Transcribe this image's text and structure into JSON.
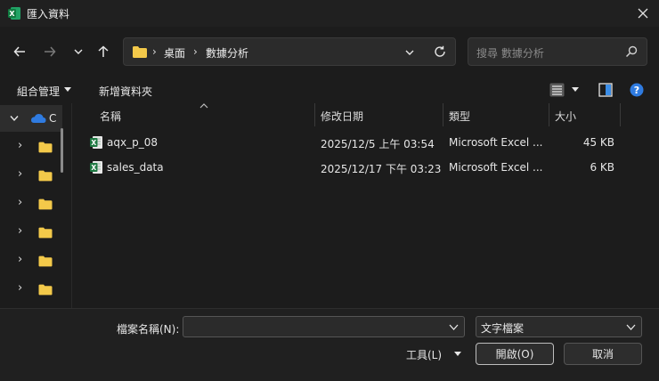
{
  "window": {
    "title": "匯入資料"
  },
  "address": {
    "crumbs": [
      "桌面",
      "數據分析"
    ]
  },
  "search": {
    "placeholder": "搜尋 數據分析"
  },
  "toolbar": {
    "organize": "組合管理",
    "new_folder": "新增資料夾"
  },
  "sidebar": {
    "top_item": "C"
  },
  "columns": {
    "name": "名稱",
    "date": "修改日期",
    "type": "類型",
    "size": "大小"
  },
  "files": [
    {
      "name": "aqx_p_08",
      "date": "2025/12/5 上午 03:54",
      "type": "Microsoft Excel ...",
      "size": "45 KB"
    },
    {
      "name": "sales_data",
      "date": "2025/12/17 下午 03:23",
      "type": "Microsoft Excel ...",
      "size": "6 KB"
    }
  ],
  "footer": {
    "filename_label": "檔案名稱(N):",
    "filetype_value": "文字檔案",
    "tools_label": "工具(L)",
    "open_label": "開啟(O)",
    "cancel_label": "取消"
  },
  "colors": {
    "background": "#1c1c1c",
    "excel_green": "#1f7a43",
    "folder_yellow": "#f3c94a",
    "help_blue": "#2f7be0"
  }
}
